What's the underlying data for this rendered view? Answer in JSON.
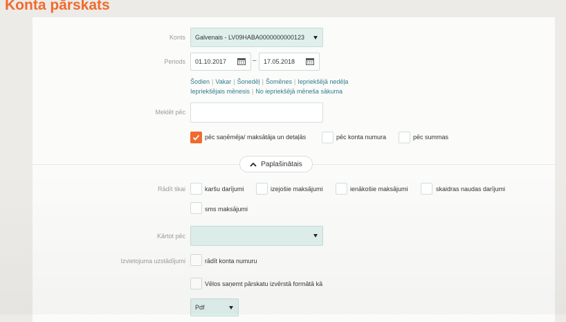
{
  "page": {
    "title": "Konta pārskats"
  },
  "account": {
    "label": "Konts",
    "value": "Galvenais - LV09HABA0000000000123"
  },
  "period": {
    "label": "Periods",
    "from": "01.10.2017",
    "dash": "–",
    "to": "17.05.2018",
    "quick_links_row1": [
      "Šodien",
      "Vakar",
      "Šonedēļ",
      "Šomēnes",
      "Iepriekšējā nedēļa"
    ],
    "quick_links_row2": [
      "Iepriekšējais mēnesis",
      "No iepriekšējā mēneša sākuma"
    ]
  },
  "search": {
    "label": "Meklēt pēc",
    "value": "",
    "options": [
      {
        "label": "pēc saņēmēja/ maksātāja un detaļās",
        "checked": true
      },
      {
        "label": "pēc konta numura",
        "checked": false
      },
      {
        "label": "pēc summas",
        "checked": false
      }
    ]
  },
  "advanced": {
    "label": "Paplašinātais"
  },
  "show_only": {
    "label": "Rādīt tikai",
    "options": [
      {
        "label": "karšu darījumi",
        "checked": false
      },
      {
        "label": "izejošie maksājumi",
        "checked": false
      },
      {
        "label": "ienākošie maksājumi",
        "checked": false
      },
      {
        "label": "skaidras naudas darījumi",
        "checked": false
      },
      {
        "label": "sms maksājumi",
        "checked": false
      }
    ]
  },
  "sort": {
    "label": "Kārtot pēc",
    "value": ""
  },
  "layout_settings": {
    "label": "Izvietojuma uzstādījumi",
    "options": [
      {
        "label": "rādīt konta numuru",
        "checked": false
      },
      {
        "label": "Vēlos saņemt pārskatu izvērstā formātā kā",
        "checked": false
      }
    ],
    "format": "Pdf"
  },
  "colors": {
    "accent": "#f06a2d",
    "link": "#2f7d8c",
    "field_green": "#dff0ec"
  }
}
